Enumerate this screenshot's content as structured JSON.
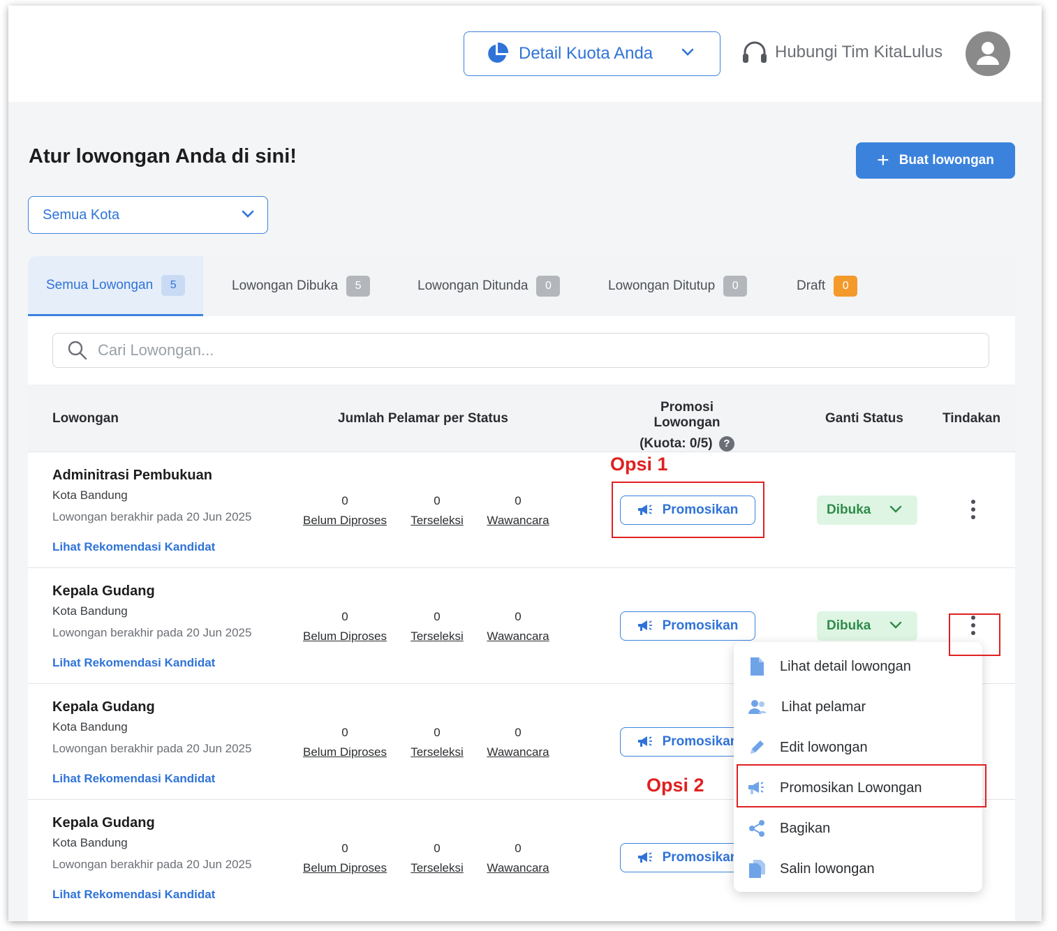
{
  "header": {
    "quota_button": "Detail Kuota Anda",
    "support_link": "Hubungi Tim KitaLulus"
  },
  "page": {
    "title": "Atur lowongan Anda di sini!",
    "create_button": "Buat lowongan",
    "city_filter": "Semua Kota"
  },
  "tabs": [
    {
      "label": "Semua Lowongan",
      "count": "5"
    },
    {
      "label": "Lowongan Dibuka",
      "count": "5"
    },
    {
      "label": "Lowongan Ditunda",
      "count": "0"
    },
    {
      "label": "Lowongan Ditutup",
      "count": "0"
    },
    {
      "label": "Draft",
      "count": "0"
    }
  ],
  "search": {
    "placeholder": "Cari Lowongan..."
  },
  "table": {
    "headers": {
      "job": "Lowongan",
      "applicants": "Jumlah Pelamar per Status",
      "promo_line1": "Promosi Lowongan",
      "promo_line2": "(Kuota: 0/5)",
      "status": "Ganti Status",
      "actions": "Tindakan"
    },
    "stat_labels": [
      "Belum Diproses",
      "Terseleksi",
      "Wawancara"
    ],
    "promote_label": "Promosikan",
    "status_label": "Dibuka",
    "rows": [
      {
        "title": "Adminitrasi Pembukuan",
        "city": "Kota Bandung",
        "end": "Lowongan berakhir pada 20 Jun 2025",
        "link": "Lihat Rekomendasi Kandidat",
        "stats": [
          "0",
          "0",
          "0"
        ]
      },
      {
        "title": "Kepala Gudang",
        "city": "Kota Bandung",
        "end": "Lowongan berakhir pada 20 Jun 2025",
        "link": "Lihat Rekomendasi Kandidat",
        "stats": [
          "0",
          "0",
          "0"
        ]
      },
      {
        "title": "Kepala Gudang",
        "city": "Kota Bandung",
        "end": "Lowongan berakhir pada 20 Jun 2025",
        "link": "Lihat Rekomendasi Kandidat",
        "stats": [
          "0",
          "0",
          "0"
        ]
      },
      {
        "title": "Kepala Gudang",
        "city": "Kota Bandung",
        "end": "Lowongan berakhir pada 20 Jun 2025",
        "link": "Lihat Rekomendasi Kandidat",
        "stats": [
          "0",
          "0",
          "0"
        ]
      }
    ]
  },
  "menu": [
    {
      "label": "Lihat detail lowongan",
      "icon": "document-icon"
    },
    {
      "label": "Lihat pelamar",
      "icon": "users-icon"
    },
    {
      "label": "Edit lowongan",
      "icon": "pencil-icon"
    },
    {
      "label": "Promosikan Lowongan",
      "icon": "megaphone-icon"
    },
    {
      "label": "Bagikan",
      "icon": "share-icon"
    },
    {
      "label": "Salin lowongan",
      "icon": "copy-icon"
    }
  ],
  "annotations": {
    "option1": "Opsi 1",
    "option2": "Opsi 2"
  },
  "colors": {
    "accent": "#3b82dd",
    "annotation": "#e02020",
    "status_open": "#dff5e3",
    "draft_badge": "#f39a2b"
  }
}
